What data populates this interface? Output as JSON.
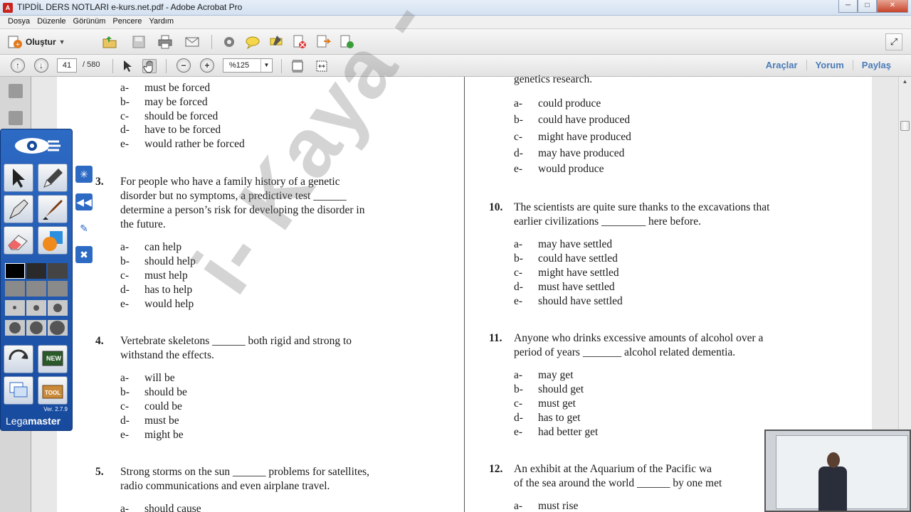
{
  "window": {
    "title": "TIPDİL DERS NOTLARI e-kurs.net.pdf - Adobe Acrobat Pro",
    "app_icon": "pdf-icon",
    "controls": [
      "minimize",
      "maximize",
      "close"
    ]
  },
  "menu": [
    "Dosya",
    "Düzenle",
    "Görünüm",
    "Pencere",
    "Yardım"
  ],
  "toolbar": {
    "create_label": "Oluştur",
    "icons": [
      "open-folder-icon",
      "save-icon",
      "print-icon",
      "email-icon",
      "gear-icon",
      "comment-icon",
      "highlight-icon",
      "delete-page-icon",
      "export-icon",
      "share-icon"
    ]
  },
  "nav": {
    "current_page": "41",
    "total_pages": "/ 580",
    "zoom": "%125",
    "links": [
      "Araçlar",
      "Yorum",
      "Paylaş"
    ]
  },
  "left_column": {
    "q2_options": [
      {
        "letter": "a-",
        "text": "must be forced"
      },
      {
        "letter": "b-",
        "text": "may be forced"
      },
      {
        "letter": "c-",
        "text": "should  be forced"
      },
      {
        "letter": "d-",
        "text": "have to be forced"
      },
      {
        "letter": "e-",
        "text": "would rather be forced"
      }
    ],
    "q3": {
      "num": "3.",
      "lines": [
        "For  people  who  have  a  family  history  of  a  genetic",
        "disorder  but  no  symptoms,  a  predictive  test  ______",
        "determine  a  person’s  risk  for  developing  the  disorder  in",
        "the future."
      ],
      "options": [
        {
          "letter": "a-",
          "text": "can help"
        },
        {
          "letter": "b-",
          "text": "should help"
        },
        {
          "letter": "c-",
          "text": "must help"
        },
        {
          "letter": "d-",
          "text": "has to help"
        },
        {
          "letter": "e-",
          "text": "would help"
        }
      ]
    },
    "q4": {
      "num": "4.",
      "lines": [
        "Vertebrate  skeletons  ______  both  rigid  and  strong  to",
        "withstand the effects."
      ],
      "options": [
        {
          "letter": "a-",
          "text": "will be"
        },
        {
          "letter": "b-",
          "text": "should be"
        },
        {
          "letter": "c-",
          "text": "could be"
        },
        {
          "letter": "d-",
          "text": "must be"
        },
        {
          "letter": "e-",
          "text": "might be"
        }
      ]
    },
    "q5": {
      "num": "5.",
      "lines": [
        "Strong  storms  on  the  sun  ______  problems  for  satellites,",
        "radio communications and even airplane travel."
      ],
      "partial_option": {
        "letter": "a-",
        "text": "should cause"
      }
    }
  },
  "right_column": {
    "q9_tail": "genetics research.",
    "q9_options": [
      {
        "letter": "a-",
        "text": "could produce"
      },
      {
        "letter": "b-",
        "text": "could have produced"
      },
      {
        "letter": "c-",
        "text": "might have produced"
      },
      {
        "letter": "d-",
        "text": "may have produced"
      },
      {
        "letter": "e-",
        "text": "would produce"
      }
    ],
    "q10": {
      "num": "10.",
      "lines": [
        "The scientists are quite sure thanks to the excavations that",
        "earlier civilizations ________ here before."
      ],
      "options": [
        {
          "letter": "a-",
          "text": "may have settled"
        },
        {
          "letter": "b-",
          "text": "could have settled"
        },
        {
          "letter": "c-",
          "text": "might have settled"
        },
        {
          "letter": "d-",
          "text": "must have settled"
        },
        {
          "letter": "e-",
          "text": "should have settled"
        }
      ]
    },
    "q11": {
      "num": "11.",
      "lines": [
        "Anyone  who  drinks  excessive  amounts  of  alcohol  over  a",
        "period of years _______ alcohol related dementia."
      ],
      "options": [
        {
          "letter": "a-",
          "text": "may get"
        },
        {
          "letter": "b-",
          "text": "should get"
        },
        {
          "letter": "c-",
          "text": "must get"
        },
        {
          "letter": "d-",
          "text": "has to get"
        },
        {
          "letter": "e-",
          "text": "had better get"
        }
      ]
    },
    "q12": {
      "num": "12.",
      "lines": [
        "An exhibit at the Aquarium of the Pacific wa",
        "of the sea around the world ______ by one met"
      ],
      "partial_option": {
        "letter": "a-",
        "text": "must rise"
      }
    }
  },
  "watermark": "i- Kaya - e-kurs.net",
  "legamaster": {
    "version": "Ver. 2.7.9",
    "brand_light": "Lega",
    "brand_bold": "master",
    "tool_new": "NEW",
    "tool_box": "TOOL"
  },
  "colors": {
    "accent_link": "#4a7bb8",
    "legamaster_blue": "#2d6ac4"
  }
}
